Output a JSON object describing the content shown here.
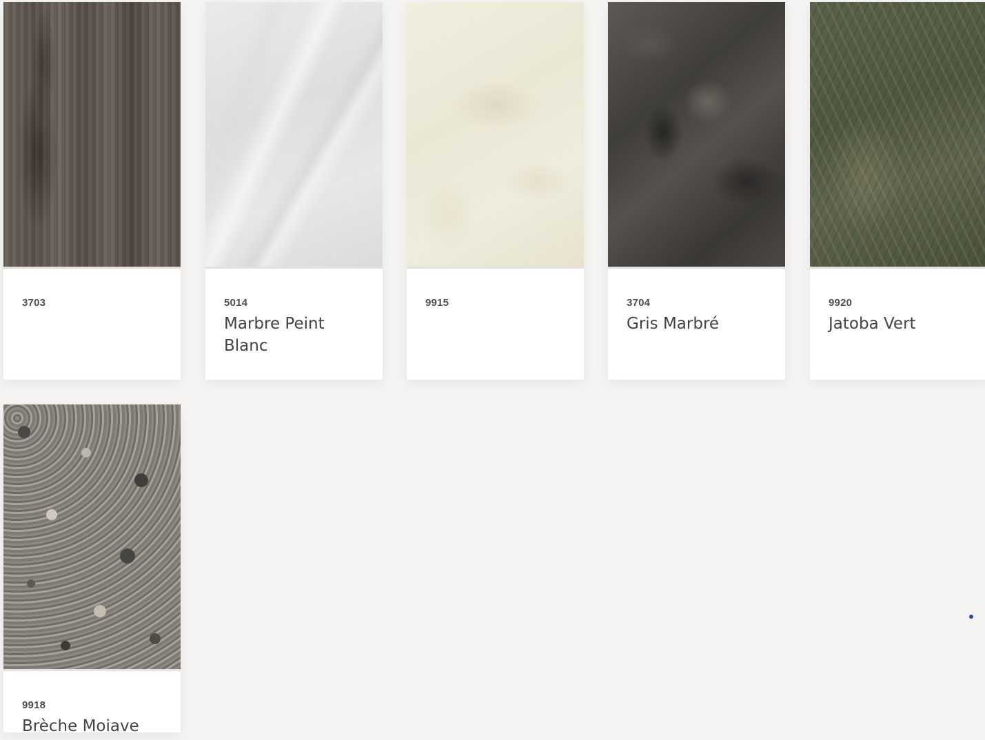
{
  "products": [
    {
      "code": "3703",
      "name": "",
      "texture": "wood-grain-swatch"
    },
    {
      "code": "5014",
      "name": "Marbre Peint Blanc",
      "texture": "white-marble-swatch"
    },
    {
      "code": "9915",
      "name": "",
      "texture": "cream-marble-swatch"
    },
    {
      "code": "3704",
      "name": "Gris Marbré",
      "texture": "dark-marble-swatch"
    },
    {
      "code": "9920",
      "name": "Jatoba Vert",
      "texture": "green-stone-swatch"
    },
    {
      "code": "9918",
      "name": "Brèche Moiave",
      "texture": "terrazzo-swatch"
    }
  ],
  "colors": {
    "background": "#f5f4f2",
    "card": "#ffffff",
    "code_text": "#4e4e4e",
    "name_text": "#444444",
    "status_dot": "#2a4aa8"
  }
}
